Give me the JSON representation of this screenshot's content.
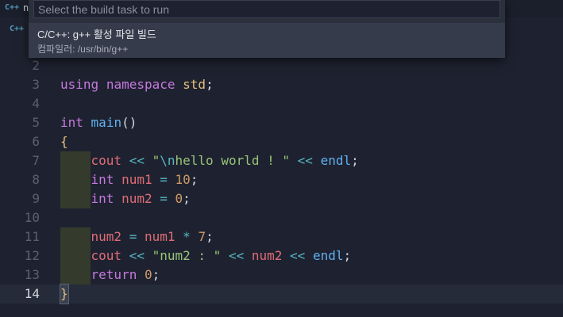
{
  "tab": {
    "icon_text": "C++",
    "fragment": "n"
  },
  "breadcrumb": {
    "icon_text": "C++"
  },
  "quick_pick": {
    "placeholder": "Select the build task to run",
    "items": [
      {
        "label": "C/C++: g++ 활성 파일 빌드",
        "detail": "컴파일러: /usr/bin/g++"
      }
    ]
  },
  "editor": {
    "line_numbers": [
      "2",
      "3",
      "4",
      "5",
      "6",
      "7",
      "8",
      "9",
      "10",
      "11",
      "12",
      "13",
      "14"
    ],
    "active_line": "14"
  }
}
